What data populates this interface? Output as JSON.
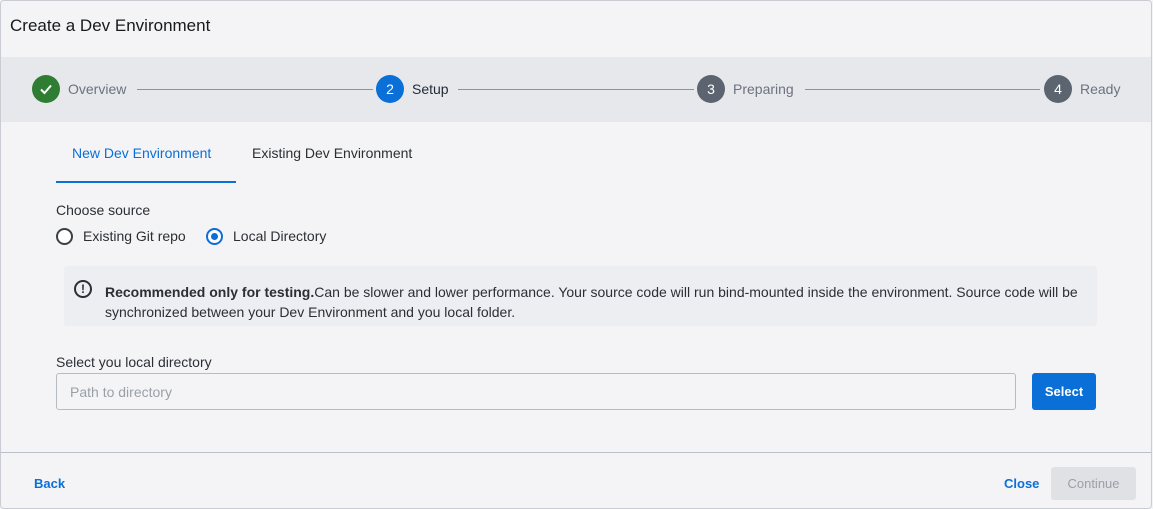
{
  "dialog": {
    "title": "Create a Dev Environment"
  },
  "stepper": {
    "steps": [
      {
        "number": "✓",
        "label": "Overview",
        "state": "complete"
      },
      {
        "number": "2",
        "label": "Setup",
        "state": "active"
      },
      {
        "number": "3",
        "label": "Preparing",
        "state": "pending"
      },
      {
        "number": "4",
        "label": "Ready",
        "state": "pending"
      }
    ]
  },
  "tabs": [
    {
      "label": "New Dev Environment",
      "active": true
    },
    {
      "label": "Existing Dev Environment",
      "active": false
    }
  ],
  "source": {
    "label": "Choose source",
    "options": [
      {
        "label": "Existing Git repo",
        "checked": false
      },
      {
        "label": "Local Directory",
        "checked": true
      }
    ]
  },
  "alert": {
    "icon": "exclamation-circle-icon",
    "bold_text": "Recommended only for testing.",
    "text": "Can be slower and lower performance. Your source code will run bind-mounted inside the environment. Source code will be synchronized between your Dev Environment and you local folder."
  },
  "directory": {
    "label": "Select you local directory",
    "placeholder": "Path to directory",
    "value": "",
    "select_label": "Select"
  },
  "footer": {
    "back_label": "Back",
    "close_label": "Close",
    "continue_label": "Continue"
  },
  "colors": {
    "accent": "#0a6fd6",
    "success": "#2e7d32",
    "pending": "#5c6470"
  }
}
